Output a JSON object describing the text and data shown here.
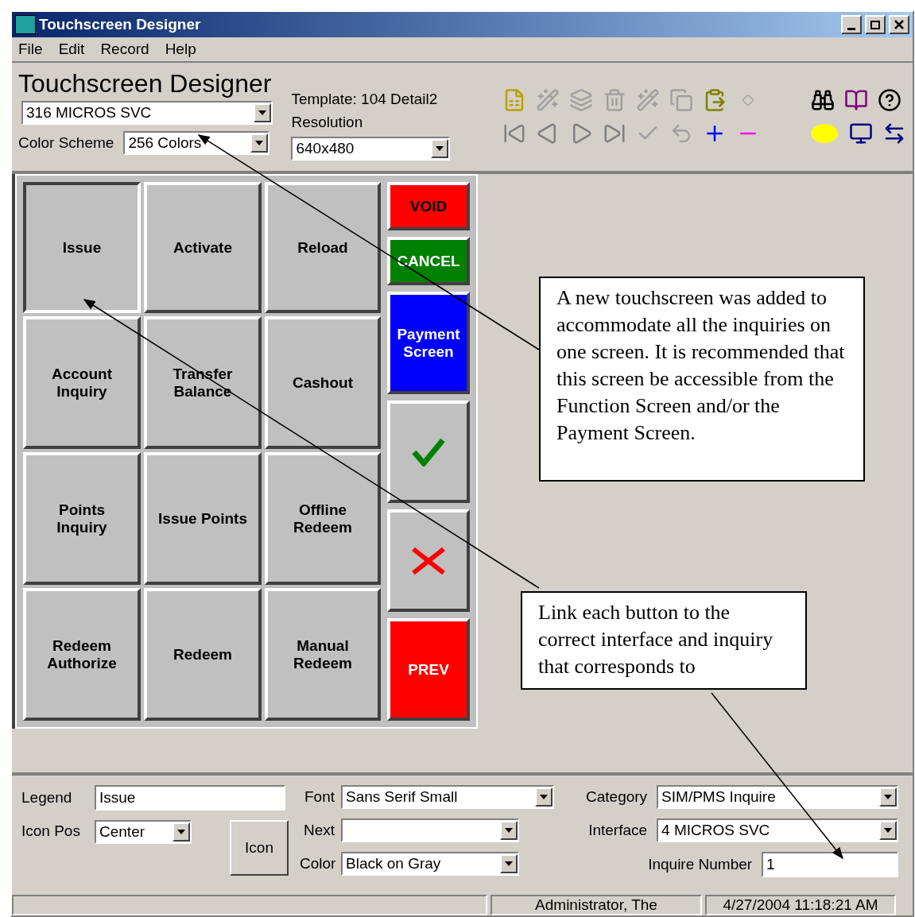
{
  "window": {
    "title": "Touchscreen Designer"
  },
  "menu": [
    "File",
    "Edit",
    "Record",
    "Help"
  ],
  "header": {
    "title": "Touchscreen Designer",
    "screen": "316  MICROS SVC",
    "color_scheme_label": "Color Scheme",
    "color_scheme": "256 Colors",
    "template": "Template: 104 Detail2",
    "resolution_label": "Resolution",
    "resolution": "640x480"
  },
  "grid_buttons": [
    {
      "label": "Issue",
      "selected": true
    },
    {
      "label": "Activate",
      "selected": false
    },
    {
      "label": "Reload",
      "selected": false
    },
    {
      "label": "Account\nInquiry",
      "selected": false
    },
    {
      "label": "Transfer\nBalance",
      "selected": false
    },
    {
      "label": "Cashout",
      "selected": false
    },
    {
      "label": "Points\nInquiry",
      "selected": false
    },
    {
      "label": "Issue Points",
      "selected": false
    },
    {
      "label": "Offline\nRedeem",
      "selected": false
    },
    {
      "label": "Redeem\nAuthorize",
      "selected": false
    },
    {
      "label": "Redeem",
      "selected": false
    },
    {
      "label": "Manual\nRedeem",
      "selected": false
    }
  ],
  "side_buttons": [
    {
      "kind": "short",
      "label": "VOID",
      "color": "#ff0000",
      "dark_text": true
    },
    {
      "kind": "short",
      "label": "CANCEL",
      "color": "#008000",
      "dark_text": false
    },
    {
      "kind": "tall",
      "label": "Payment\nScreen",
      "color": "#0000ff",
      "dark_text": false
    },
    {
      "kind": "check",
      "color": "#c0c0c0"
    },
    {
      "kind": "cross",
      "color": "#c0c0c0"
    },
    {
      "kind": "tall",
      "label": "PREV",
      "color": "#ff0000",
      "dark_text": false
    }
  ],
  "properties": {
    "legend_label": "Legend",
    "legend": "Issue",
    "icon_pos_label": "Icon Pos",
    "icon_pos": "Center",
    "icon_button": "Icon",
    "font_label": "Font",
    "font": "Sans Serif Small",
    "next_label": "Next",
    "color_label": "Color",
    "button_color": "Black on Gray",
    "category_label": "Category",
    "category": "SIM/PMS Inquire",
    "interface_label": "Interface",
    "interface": "4  MICROS SVC",
    "inquire_label": "Inquire Number",
    "inquire": "1"
  },
  "status_bar": [
    "Administrator, The",
    "4/27/2004 11:18:21 AM"
  ],
  "annotations": [
    "A new touchscreen was added to accommodate all the inquiries on one screen.  It is recommended that this screen be accessible from the Function Screen and/or the Payment Screen.",
    "Link each button to the correct interface and inquiry that corresponds to"
  ]
}
